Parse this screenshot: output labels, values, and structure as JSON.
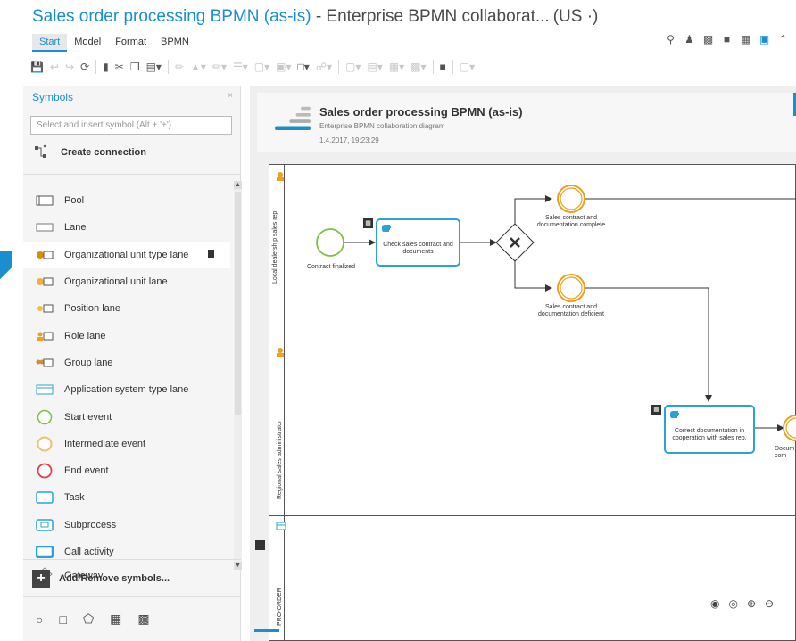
{
  "title": {
    "main": "Sales order processing BPMN (as-is)",
    "rest": " - Enterprise BPMN collaborat...",
    "lang": "(US ·)"
  },
  "ribbon": {
    "tabs": [
      "Start",
      "Model",
      "Format",
      "BPMN"
    ],
    "active_tab": "Start"
  },
  "panel": {
    "title": "Symbols",
    "close": "×",
    "search_placeholder": "Select and insert symbol (Alt + '+')",
    "create_connection": "Create connection",
    "add_remove": "Add/Remove symbols...",
    "items": [
      {
        "label": "Pool",
        "icon": "pool-icon"
      },
      {
        "label": "Lane",
        "icon": "lane-icon"
      },
      {
        "label": "Organizational unit type lane",
        "icon": "org-unit-type-lane-icon"
      },
      {
        "label": "Organizational unit lane",
        "icon": "org-unit-lane-icon"
      },
      {
        "label": "Position lane",
        "icon": "position-lane-icon"
      },
      {
        "label": "Role lane",
        "icon": "role-lane-icon"
      },
      {
        "label": "Group lane",
        "icon": "group-lane-icon"
      },
      {
        "label": "Application system type lane",
        "icon": "app-system-lane-icon"
      },
      {
        "label": "Start event",
        "icon": "start-event-icon"
      },
      {
        "label": "Intermediate event",
        "icon": "intermediate-event-icon"
      },
      {
        "label": "End event",
        "icon": "end-event-icon"
      },
      {
        "label": "Task",
        "icon": "task-icon"
      },
      {
        "label": "Subprocess",
        "icon": "subprocess-icon"
      },
      {
        "label": "Call activity",
        "icon": "call-activity-icon"
      },
      {
        "label": "Gateway",
        "icon": "gateway-icon"
      }
    ]
  },
  "diagram": {
    "title": "Sales order processing BPMN (as-is)",
    "subtitle": "Enterprise BPMN collaboration diagram",
    "date": "1.4.2017, 19:23:29",
    "lanes": [
      "Local dealership sales rep",
      "Regional sales administrator",
      "PRO-ORDER"
    ],
    "start_event": "Contract finalized",
    "task1": "Check sales contract and documents",
    "event_complete": "Sales contract and documentation complete",
    "event_deficient": "Sales contract and documentation deficient",
    "task2": "Correct documentation in cooperation with sales rep.",
    "cut_label": "Docum com"
  },
  "colors": {
    "accent": "#1a8fcf",
    "task_border": "#2aa3d4",
    "start_event": "#7dc142",
    "intermediate_event": "#f0a020",
    "end_event": "#e04040"
  }
}
